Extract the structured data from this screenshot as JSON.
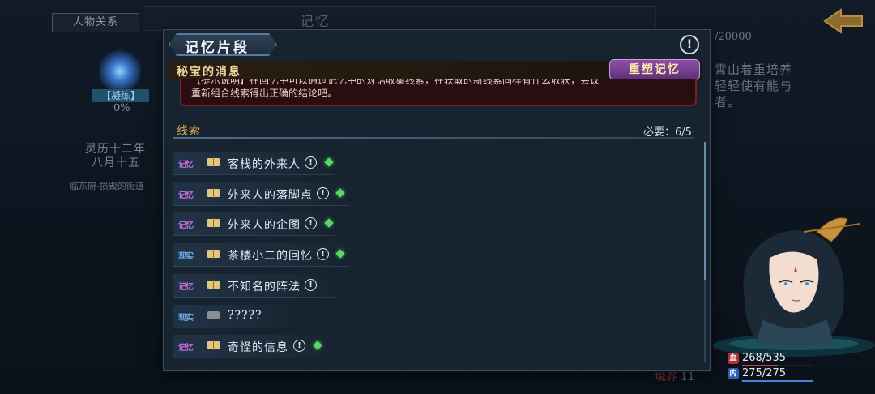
{
  "background": {
    "tab_button": "人物关系",
    "top_title": "记忆",
    "stage_badge": "【凝练】",
    "percent": "0%",
    "date_line1": "灵历十二年",
    "date_line2": "八月十五",
    "location": "临东府-损毁的街道",
    "count": "/20000",
    "desc_lines": [
      "霄山着重培养",
      "轻轻使有能与",
      "者。"
    ],
    "level_label": "境界",
    "level_value": "11"
  },
  "dialog": {
    "title": "记忆片段",
    "quest_title": "秘宝的消息",
    "rebuild_button": "重塑记忆",
    "description_line1": "【提示说明】在回忆中可以通过记忆中的对话收集线索，在获取的新线索同样有什么收获，会议",
    "description_line2": "重新组合线索得出正确的结论吧。",
    "section_label": "线索",
    "required": "必要：6/5",
    "clues": [
      {
        "tag": "记忆",
        "type": "memory",
        "name": "客栈的外来人",
        "gem": true
      },
      {
        "tag": "记忆",
        "type": "memory",
        "name": "外来人的落脚点",
        "gem": true
      },
      {
        "tag": "记忆",
        "type": "memory",
        "name": "外来人的企图",
        "gem": true
      },
      {
        "tag": "现实",
        "type": "reality",
        "name": "茶楼小二的回忆",
        "gem": true
      },
      {
        "tag": "记忆",
        "type": "memory",
        "name": "不知名的阵法",
        "gem": false
      },
      {
        "tag": "现实",
        "type": "reality",
        "name": "?????",
        "gem": false
      },
      {
        "tag": "记忆",
        "type": "memory",
        "name": "奇怪的信息",
        "gem": true
      }
    ]
  },
  "character": {
    "hp_label": "血",
    "hp": "268/535",
    "hp_ratio": 0.501,
    "mp_label": "内",
    "mp": "275/275",
    "mp_ratio": 1.0
  },
  "colors": {
    "memory_tag": "#c26fe0",
    "reality_tag": "#6fa9e8",
    "gem": "#5bd66a",
    "rebuild_button": "#8e4fa8"
  }
}
